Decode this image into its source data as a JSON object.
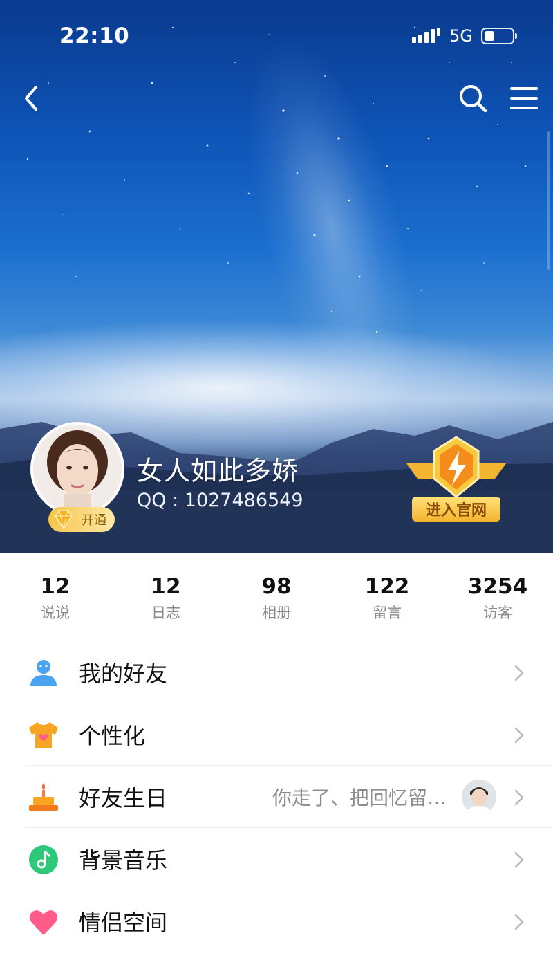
{
  "status_bar": {
    "time": "22:10",
    "network": "5G",
    "battery_level": 0.35
  },
  "profile": {
    "nickname": "女人如此多娇",
    "qq": "QQ : 1027486549",
    "vip_label": "开通",
    "official_site_label": "进入官网"
  },
  "stats": [
    {
      "value": "12",
      "label": "说说"
    },
    {
      "value": "12",
      "label": "日志"
    },
    {
      "value": "98",
      "label": "相册"
    },
    {
      "value": "122",
      "label": "留言"
    },
    {
      "value": "3254",
      "label": "访客"
    }
  ],
  "menu": [
    {
      "label": "我的好友",
      "icon": "friends-icon",
      "subtitle": ""
    },
    {
      "label": "个性化",
      "icon": "tshirt-icon",
      "subtitle": ""
    },
    {
      "label": "好友生日",
      "icon": "birthday-cake-icon",
      "subtitle": "你走了、把回忆留…"
    },
    {
      "label": "背景音乐",
      "icon": "music-note-icon",
      "subtitle": ""
    },
    {
      "label": "情侣空间",
      "icon": "heart-icon",
      "subtitle": ""
    }
  ],
  "colors": {
    "accent_blue": "#4aa3f0",
    "orange": "#f6a623",
    "green": "#2ec87a",
    "pink": "#ff5c8a"
  }
}
